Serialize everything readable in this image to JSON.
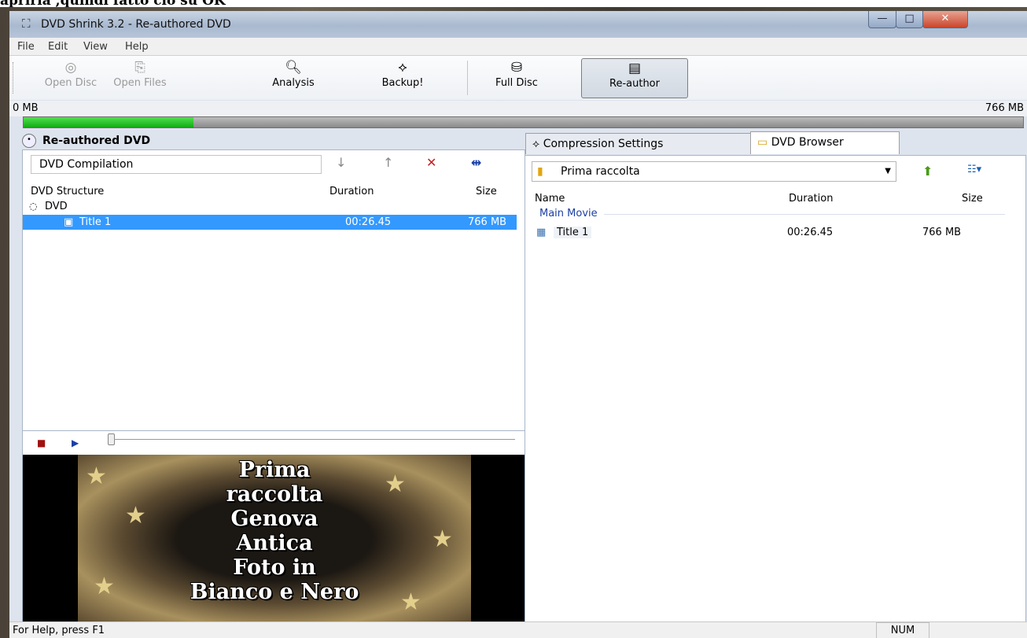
{
  "caption": "aprirla ,quindi fatto ciò su OK",
  "window": {
    "title": "DVD Shrink 3.2 - Re-authored DVD",
    "buttons": {
      "minimize": "—",
      "maximize": "□",
      "close": "✕"
    }
  },
  "menu": [
    "File",
    "Edit",
    "View",
    "Help"
  ],
  "toolbar": {
    "open_disc": "Open Disc",
    "open_files": "Open Files",
    "analysis": "Analysis",
    "backup": "Backup!",
    "full_disc": "Full Disc",
    "reauthor": "Re-author"
  },
  "size_bar": {
    "left": "0 MB",
    "right": "766 MB",
    "progress_fraction": 0.17
  },
  "left_panel": {
    "header": "Re-authored DVD",
    "compilation_name": "DVD Compilation",
    "columns": {
      "structure": "DVD Structure",
      "duration": "Duration",
      "size": "Size"
    },
    "tree_root": "DVD",
    "rows": [
      {
        "name": "Title 1",
        "duration": "00:26.45",
        "size": "766 MB"
      }
    ]
  },
  "player": {
    "video_text_lines": [
      "Prima",
      "raccolta",
      "Genova",
      "Antica",
      "Foto in",
      "Bianco e Nero"
    ]
  },
  "right_panel": {
    "tabs": {
      "compression": "Compression Settings",
      "browser": "DVD Browser"
    },
    "folder": "Prima raccolta",
    "columns": {
      "name": "Name",
      "duration": "Duration",
      "size": "Size"
    },
    "group": "Main Movie",
    "rows": [
      {
        "name": "Title 1",
        "duration": "00:26.45",
        "size": "766 MB"
      }
    ]
  },
  "status": {
    "text": "For Help, press F1",
    "num": "NUM"
  }
}
